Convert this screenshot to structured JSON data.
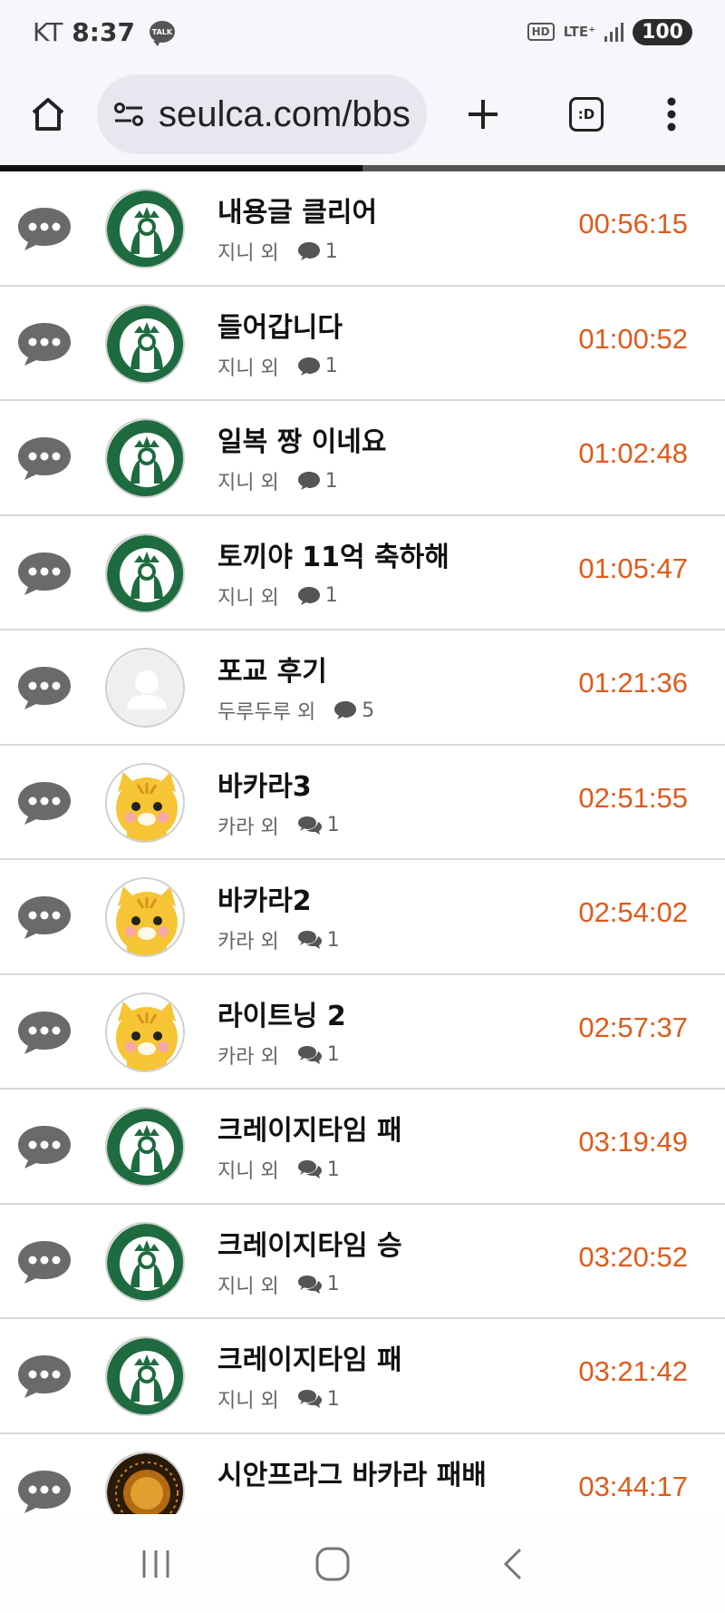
{
  "status": {
    "carrier": "KT",
    "time": "8:37",
    "talk": "TALK",
    "hd": "HD",
    "lte": "LTE⁺",
    "battery": "100"
  },
  "browser": {
    "url": "seulca.com/bbs",
    "tabs_label": ":D"
  },
  "rows": [
    {
      "title": "내용글 클리어",
      "author": "지니 외",
      "comments": "1",
      "time": "00:56:15",
      "avatar": "starbucks",
      "comment_icon": "single"
    },
    {
      "title": "들어갑니다",
      "author": "지니 외",
      "comments": "1",
      "time": "01:00:52",
      "avatar": "starbucks",
      "comment_icon": "single"
    },
    {
      "title": "일복 짱 이네요",
      "author": "지니 외",
      "comments": "1",
      "time": "01:02:48",
      "avatar": "starbucks",
      "comment_icon": "single"
    },
    {
      "title": "토끼야 11억 축하해",
      "author": "지니 외",
      "comments": "1",
      "time": "01:05:47",
      "avatar": "starbucks",
      "comment_icon": "single"
    },
    {
      "title": "포교 후기",
      "author": "두루두루 외",
      "comments": "5",
      "time": "01:21:36",
      "avatar": "default",
      "comment_icon": "single"
    },
    {
      "title": "바카라3",
      "author": "카라 외",
      "comments": "1",
      "time": "02:51:55",
      "avatar": "tiger",
      "comment_icon": "double"
    },
    {
      "title": "바카라2",
      "author": "카라 외",
      "comments": "1",
      "time": "02:54:02",
      "avatar": "tiger",
      "comment_icon": "double"
    },
    {
      "title": "라이트닝 2",
      "author": "카라 외",
      "comments": "1",
      "time": "02:57:37",
      "avatar": "tiger",
      "comment_icon": "double"
    },
    {
      "title": "크레이지타임 패",
      "author": "지니 외",
      "comments": "1",
      "time": "03:19:49",
      "avatar": "starbucks",
      "comment_icon": "double"
    },
    {
      "title": "크레이지타임 승",
      "author": "지니 외",
      "comments": "1",
      "time": "03:20:52",
      "avatar": "starbucks",
      "comment_icon": "double"
    },
    {
      "title": "크레이지타임 패",
      "author": "지니 외",
      "comments": "1",
      "time": "03:21:42",
      "avatar": "starbucks",
      "comment_icon": "double"
    },
    {
      "title": "시안프라그 바카라 패배",
      "author": "",
      "comments": "",
      "time": "03:44:17",
      "avatar": "play",
      "comment_icon": "double"
    }
  ],
  "colors": {
    "time": "#e05a1a",
    "starbucks_green": "#1e6b3f",
    "tiger_yellow": "#f5c536"
  }
}
